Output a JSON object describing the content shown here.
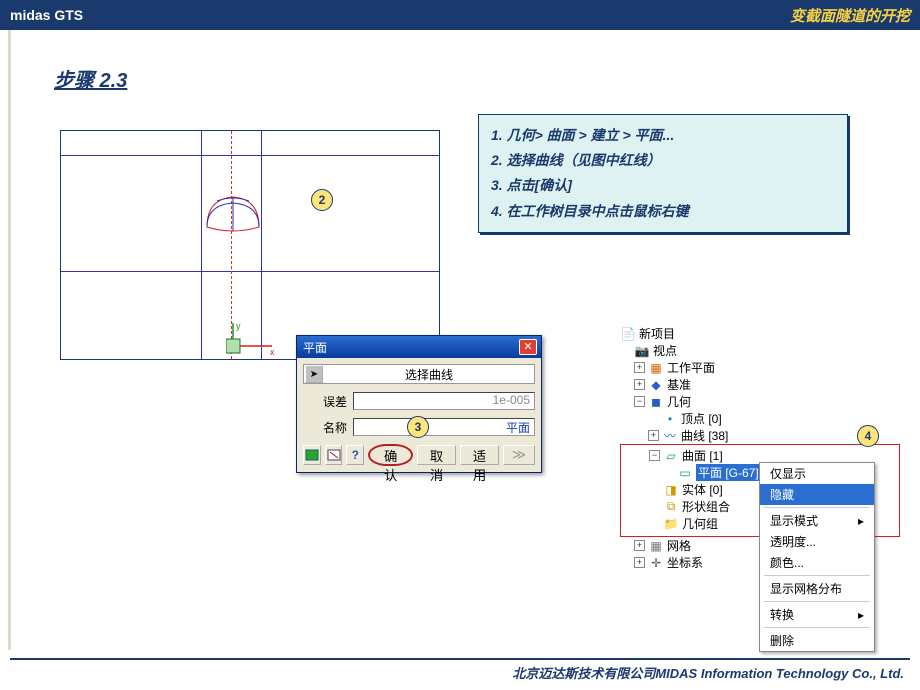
{
  "header": {
    "app": "midas GTS",
    "doc": "变截面隧道的开挖"
  },
  "step": "步骤 2.3",
  "instructions": [
    "1. 几何> 曲面 > 建立 > 平面...",
    "2. 选择曲线（见图中红线）",
    "3. 点击[确认]",
    "4. 在工作树目录中点击鼠标右键"
  ],
  "callouts": {
    "c2": "2",
    "c3": "3",
    "c4": "4"
  },
  "dialog": {
    "title": "平面",
    "select_label": "选择曲线",
    "tol_label": "误差",
    "tol_value": "1e-005",
    "name_label": "名称",
    "name_value": "平面",
    "ok": "确认",
    "cancel": "取消",
    "apply": "适用",
    "next": "≫"
  },
  "tree": {
    "new_project": "新项目",
    "view": "视点",
    "workplane": "工作平面",
    "datum": "基准",
    "geometry": "几何",
    "vertex": "顶点 [0]",
    "curve": "曲线 [38]",
    "surface": "曲面 [1]",
    "plane": "平面 [G-67]",
    "solid": "实体 [0]",
    "compound": "形状组合",
    "geogroup": "几何组",
    "mesh": "网格",
    "csys": "坐标系"
  },
  "context": {
    "show_only": "仅显示",
    "hide": "隐藏",
    "display_mode": "显示模式",
    "transparency": "透明度...",
    "color": "颜色...",
    "show_mesh": "显示网格分布",
    "transform": "转换",
    "delete": "删除"
  },
  "footer": "北京迈达斯技术有限公司MIDAS Information Technology Co., Ltd."
}
